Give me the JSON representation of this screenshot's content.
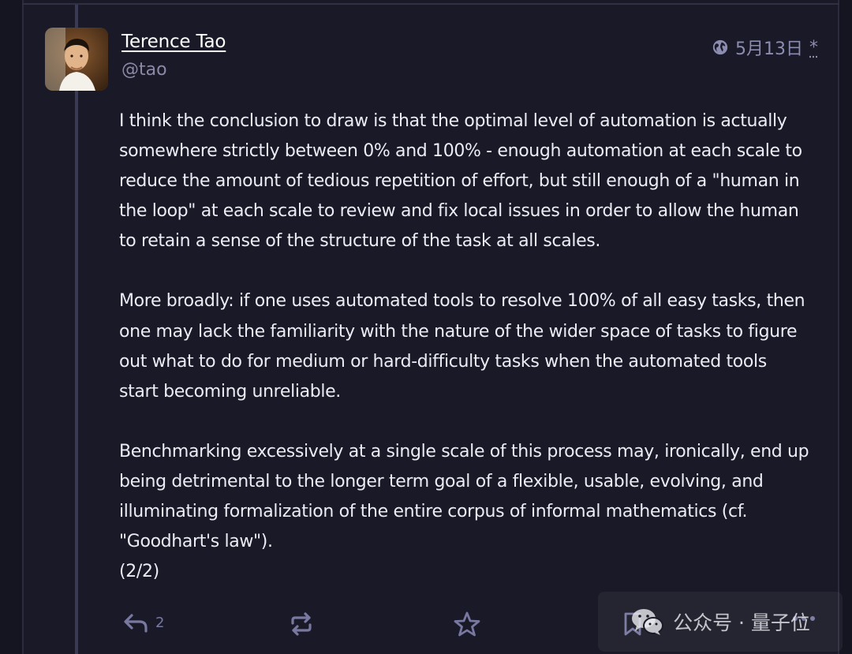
{
  "post": {
    "author": {
      "display_name": "Terence Tao",
      "handle": "@tao"
    },
    "timestamp": {
      "date": "5月13日",
      "edited_marker": "*"
    },
    "paragraphs": [
      "I think the conclusion to draw is that the optimal level of automation is actually\nsomewhere strictly between 0% and 100% - enough automation at each scale to\nreduce the amount of tedious repetition of effort, but still enough of a \"human in\nthe loop\" at each scale to review and fix local issues in order to allow the human\nto retain a sense of the structure of the task at all scales.",
      "More broadly: if one uses automated tools to resolve 100% of all easy tasks, then\none may lack the familiarity with the nature of the wider space of tasks to figure\nout what to do for medium or hard-difficulty tasks when the automated tools\nstart becoming unreliable.",
      "Benchmarking excessively at a single scale of this process may, ironically, end up\nbeing detrimental to the longer term goal of a flexible, usable, evolving, and\nilluminating formalization of the entire corpus of informal mathematics (cf.\n\"Goodhart's law\").\n(2/2)"
    ],
    "actions": {
      "reply_count": "2",
      "reply_icon": "reply-icon",
      "boost_icon": "boost-icon",
      "favourite_icon": "star-icon",
      "bookmark_icon": "bookmark-icon",
      "more_icon": "more-icon"
    }
  },
  "watermark": {
    "text": "公众号 · 量子位",
    "icon": "wechat-icon"
  },
  "colors": {
    "background": "#191927",
    "text": "#ececf4",
    "muted": "#8c8cb0",
    "action_icon": "#7878a0"
  }
}
